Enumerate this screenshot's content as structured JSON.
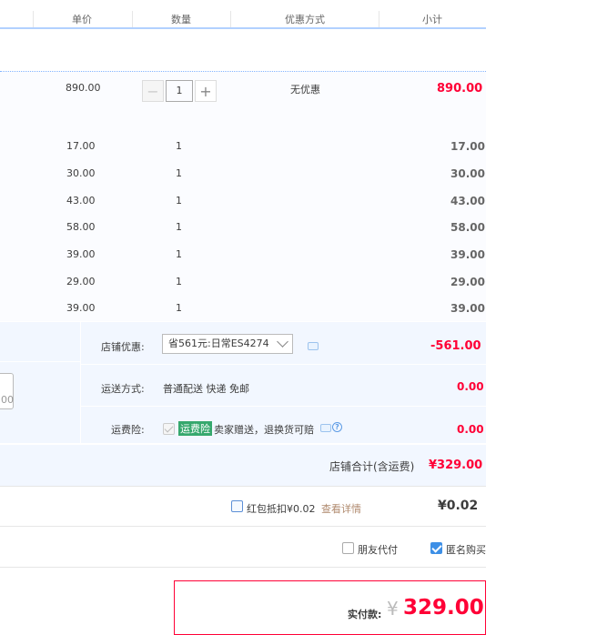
{
  "header": {
    "price": "单价",
    "quantity": "数量",
    "discount": "优惠方式",
    "subtotal": "小计"
  },
  "main_item": {
    "price": "890.00",
    "quantity": "1",
    "discount": "无优惠",
    "subtotal": "890.00"
  },
  "sub_items": [
    {
      "price": "17.00",
      "quantity": "1",
      "subtotal": "17.00"
    },
    {
      "price": "30.00",
      "quantity": "1",
      "subtotal": "30.00"
    },
    {
      "price": "43.00",
      "quantity": "1",
      "subtotal": "43.00"
    },
    {
      "price": "58.00",
      "quantity": "1",
      "subtotal": "58.00"
    },
    {
      "price": "39.00",
      "quantity": "1",
      "subtotal": "39.00"
    },
    {
      "price": "29.00",
      "quantity": "1",
      "subtotal": "29.00"
    },
    {
      "price": "39.00",
      "quantity": "1",
      "subtotal": "39.00"
    }
  ],
  "shop": {
    "promo_label": "店铺优惠:",
    "promo_selected": "省561元:日常ES4274",
    "promo_amount": "-561.00",
    "shipping_label": "运送方式:",
    "shipping_value": "普通配送 快递 免邮",
    "shipping_amount": "0.00",
    "insurance_label": "运费险:",
    "insurance_tag": "运费险",
    "insurance_text": "卖家赠送，退换货可赔",
    "insurance_amount": "0.00",
    "partial_input": "00",
    "total_label": "店铺合计(含运费)",
    "total_amount": "¥329.00"
  },
  "redpacket": {
    "label": "红包抵扣¥0.02",
    "details_link": "查看详情",
    "amount": "¥0.02"
  },
  "options": {
    "friend_pay": "朋友代付",
    "anonymous": "匿名购买"
  },
  "payment": {
    "label": "实付款:",
    "currency": "¥",
    "amount": "329.00"
  },
  "colors": {
    "accent_red": "#ff0036",
    "header_line": "#b2d1ff",
    "shop_bg": "#f2f7ff",
    "checkbox_blue": "#3d8fe6"
  }
}
